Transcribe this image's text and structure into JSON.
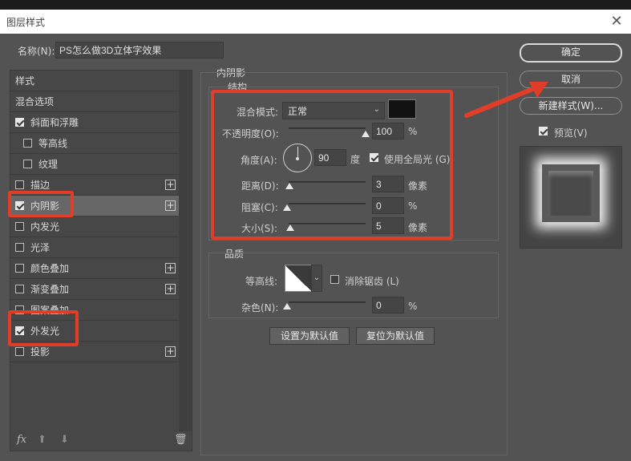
{
  "window": {
    "title": "图层样式",
    "close_glyph": "✕"
  },
  "name_field": {
    "label": "名称(N):",
    "value": "PS怎么做3D立体字效果"
  },
  "left_panel": {
    "items": [
      {
        "label": "样式",
        "checkbox": false,
        "checked": false,
        "plus": false
      },
      {
        "label": "混合选项",
        "checkbox": false,
        "checked": false,
        "plus": false
      },
      {
        "label": "斜面和浮雕",
        "checkbox": true,
        "checked": true,
        "plus": false
      },
      {
        "label": "等高线",
        "checkbox": true,
        "checked": false,
        "plus": false
      },
      {
        "label": "纹理",
        "checkbox": true,
        "checked": false,
        "plus": false
      },
      {
        "label": "描边",
        "checkbox": true,
        "checked": false,
        "plus": true
      },
      {
        "label": "内阴影",
        "checkbox": true,
        "checked": true,
        "plus": true,
        "selected": true
      },
      {
        "label": "内发光",
        "checkbox": true,
        "checked": false,
        "plus": false
      },
      {
        "label": "光泽",
        "checkbox": true,
        "checked": false,
        "plus": false
      },
      {
        "label": "颜色叠加",
        "checkbox": true,
        "checked": false,
        "plus": true
      },
      {
        "label": "渐变叠加",
        "checkbox": true,
        "checked": false,
        "plus": true
      },
      {
        "label": "图案叠加",
        "checkbox": true,
        "checked": false,
        "plus": false
      },
      {
        "label": "外发光",
        "checkbox": true,
        "checked": true,
        "plus": false
      },
      {
        "label": "投影",
        "checkbox": true,
        "checked": false,
        "plus": true
      }
    ],
    "footer": {
      "fx": "fx",
      "up": "⬆",
      "down": "⬇",
      "trash": "🗑"
    }
  },
  "inner_shadow": {
    "section_title": "内阴影",
    "structure_title": "结构",
    "blend_mode_label": "混合模式:",
    "blend_mode_value": "正常",
    "shadow_color": "#121212",
    "opacity_label": "不透明度(O):",
    "opacity_value": "100",
    "opacity_unit": "%",
    "opacity_level": 1.0,
    "angle_label": "角度(A):",
    "angle_value": "90",
    "angle_unit": "度",
    "global_light_label": "使用全局光 (G)",
    "global_light_checked": true,
    "distance_label": "距离(D):",
    "distance_value": "3",
    "distance_unit": "像素",
    "choke_label": "阻塞(C):",
    "choke_value": "0",
    "choke_unit": "%",
    "size_label": "大小(S):",
    "size_value": "5",
    "size_unit": "像素"
  },
  "quality": {
    "title": "品质",
    "contour_label": "等高线:",
    "antialias_label": "消除锯齿 (L)",
    "antialias_checked": false,
    "noise_label": "杂色(N):",
    "noise_value": "0",
    "noise_unit": "%"
  },
  "buttons": {
    "set_default": "设置为默认值",
    "reset_default": "复位为默认值",
    "ok": "确定",
    "cancel": "取消",
    "new_style": "新建样式(W)...",
    "preview_label": "预览(V)",
    "preview_checked": true
  },
  "colors": {
    "annotation_red": "#e23d28",
    "dialog_bg": "#535353"
  }
}
